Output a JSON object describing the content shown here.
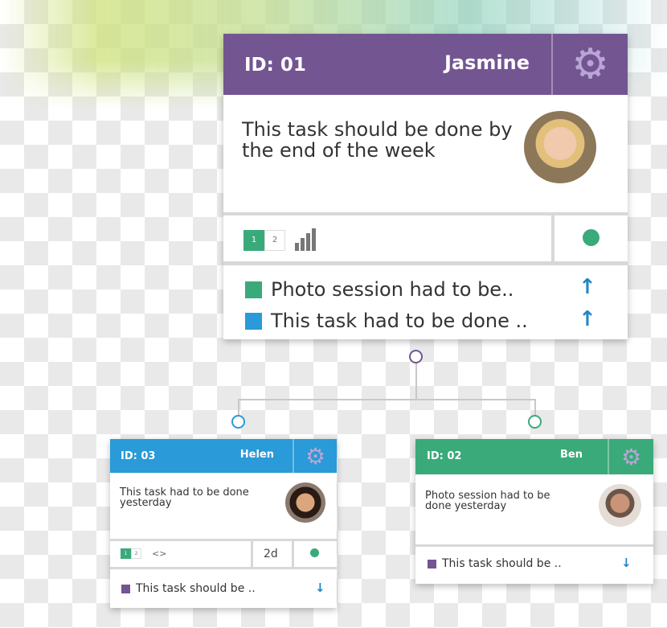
{
  "colors": {
    "purple": "#735592",
    "blue": "#2a9ad8",
    "green": "#3aaa7a",
    "arrow": "#1f86c7"
  },
  "main": {
    "id": "ID: 01",
    "name": "Jasmine",
    "description_line1": "This task should be done by",
    "description_line2": "the end of the week",
    "pages": [
      "1",
      "2"
    ],
    "active_page": "1",
    "icons": [
      "gear-icon",
      "bar-chart-icon",
      "status-dot",
      "arrow-up-icon"
    ],
    "subtasks": [
      {
        "label": "Photo session had to be..",
        "color": "#3aaa7a",
        "arrow": "↑"
      },
      {
        "label": "This task had to be done ..",
        "color": "#2a9ad8",
        "arrow": "↑"
      }
    ]
  },
  "helen": {
    "id": "ID: 03",
    "name": "Helen",
    "description_line1": "This task had to be done",
    "description_line2": "yesterday",
    "pages": [
      "1",
      "2"
    ],
    "code": "<>",
    "duration": "2d",
    "subtasks": [
      {
        "label": "This task should be ..",
        "color": "#735592",
        "arrow": "↓"
      }
    ]
  },
  "ben": {
    "id": "ID: 02",
    "name": "Ben",
    "description_line1": "Photo session  had to be",
    "description_line2": "done yesterday",
    "subtasks": [
      {
        "label": "This task should be ..",
        "color": "#735592",
        "arrow": "↓"
      }
    ]
  }
}
